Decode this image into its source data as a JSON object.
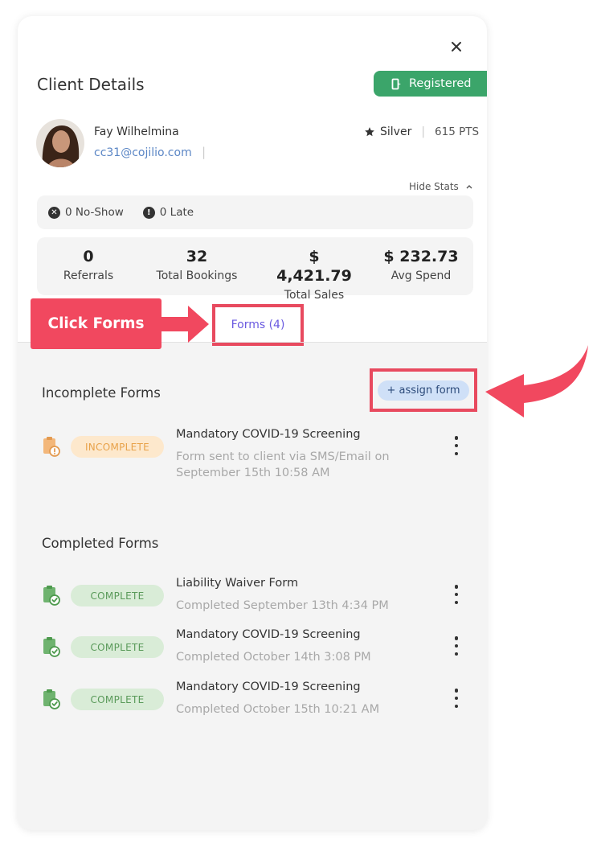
{
  "header": {
    "title": "Client Details",
    "registered_label": "Registered",
    "close_icon": "close-icon"
  },
  "client": {
    "name": "Fay Wilhelmina",
    "email": "cc31@cojilio.com",
    "separator": "|",
    "tier": "Silver",
    "points": "615 PTS",
    "tier_separator": "|"
  },
  "stats": {
    "toggle_label": "Hide Stats",
    "no_show": "0 No-Show",
    "late": "0 Late",
    "items": [
      {
        "value": "0",
        "label": "Referrals"
      },
      {
        "value": "32",
        "label": "Total Bookings"
      },
      {
        "value": "$ 4,421.79",
        "label": "Total Sales"
      },
      {
        "value": "$ 232.73",
        "label": "Avg Spend"
      }
    ]
  },
  "annotation": {
    "callout": "Click Forms"
  },
  "tabs": {
    "forms": "Forms (4)"
  },
  "incomplete": {
    "heading": "Incomplete Forms",
    "assign_label": "+ assign form",
    "forms": [
      {
        "status": "INCOMPLETE",
        "title": "Mandatory COVID-19 Screening",
        "subtitle": "Form sent to client via SMS/Email on September 15th 10:58 AM"
      }
    ]
  },
  "completed": {
    "heading": "Completed Forms",
    "forms": [
      {
        "status": "COMPLETE",
        "title": "Liability Waiver Form",
        "subtitle": "Completed September 13th 4:34 PM"
      },
      {
        "status": "COMPLETE",
        "title": "Mandatory COVID-19 Screening",
        "subtitle": "Completed October 14th 3:08 PM"
      },
      {
        "status": "COMPLETE",
        "title": "Mandatory COVID-19 Screening",
        "subtitle": "Completed October 15th 10:21 AM"
      }
    ]
  },
  "colors": {
    "registered": "#3ba56a",
    "annotation": "#f1485f",
    "tab_text": "#6a5ae0",
    "incomplete_badge": "#fde8cc",
    "complete_badge": "#d9ecd7"
  }
}
